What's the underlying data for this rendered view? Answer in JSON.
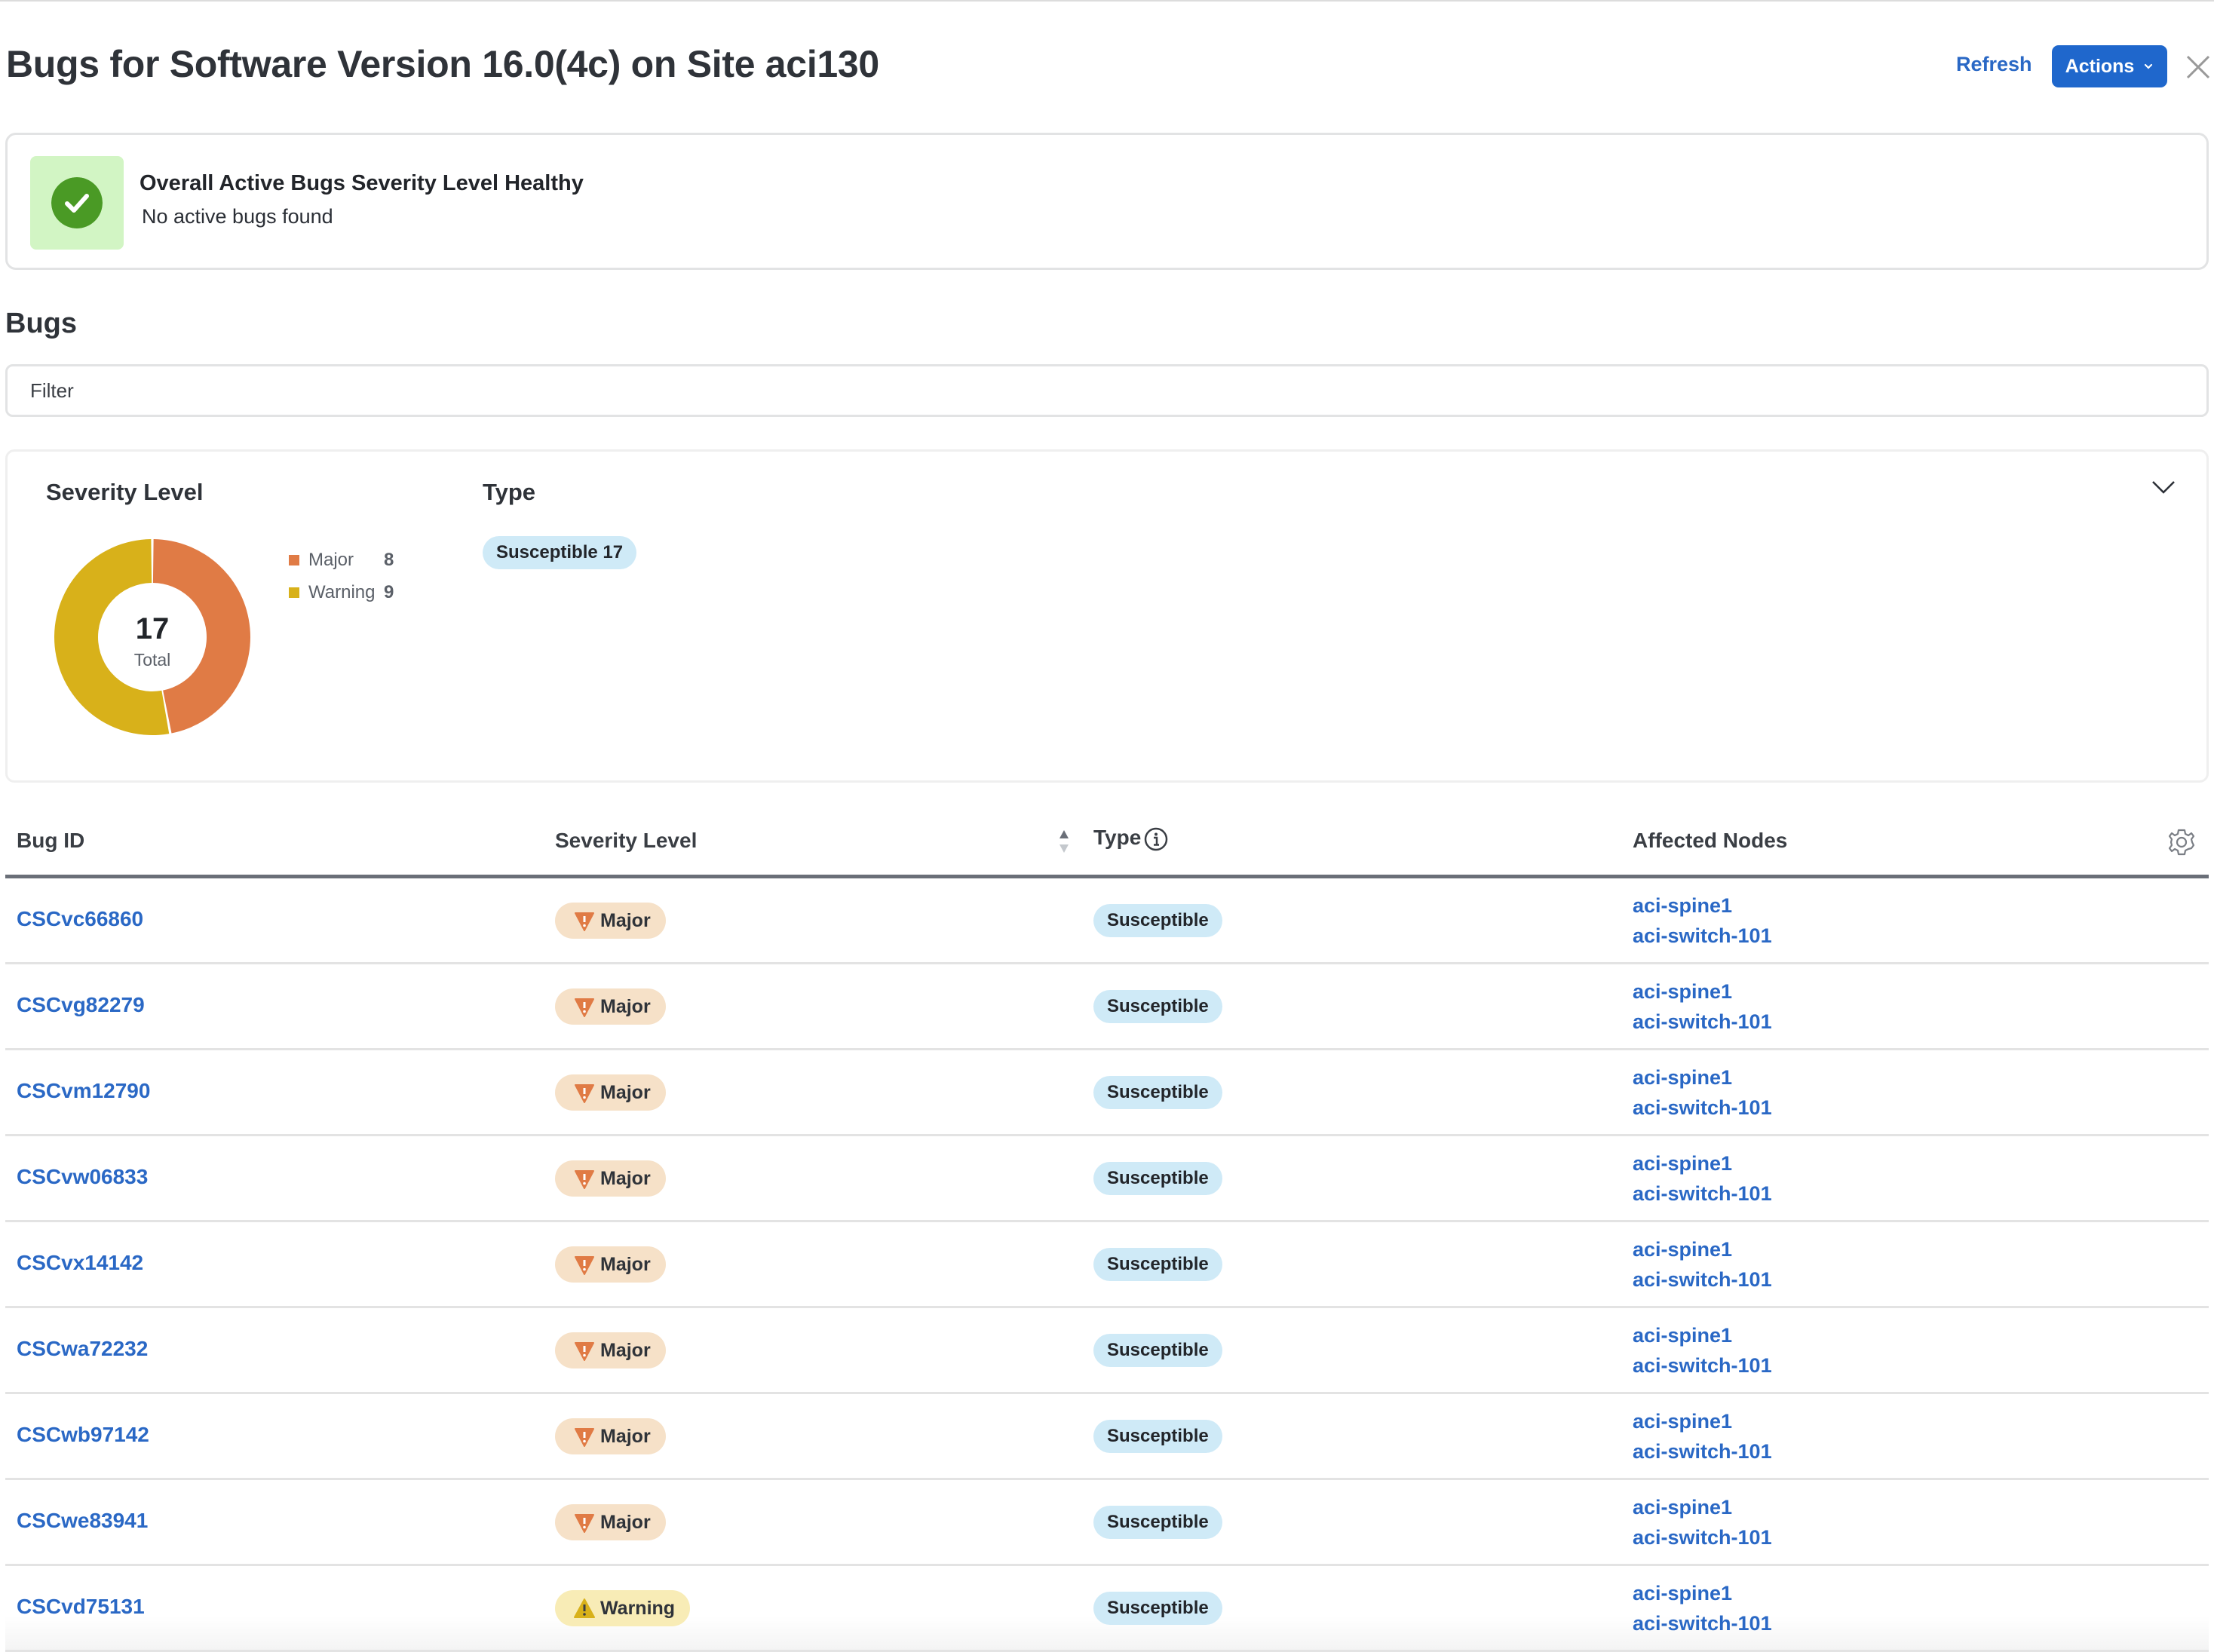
{
  "header": {
    "title": "Bugs for Software Version 16.0(4c) on Site aci130",
    "refresh_label": "Refresh",
    "actions_label": "Actions",
    "close_icon": "close-icon"
  },
  "status": {
    "icon": "check-circle-icon",
    "title": "Overall Active Bugs Severity Level Healthy",
    "subtitle": "No active bugs found",
    "color": "#4a9a25"
  },
  "bugs_section": {
    "heading": "Bugs",
    "filter_placeholder": "Filter"
  },
  "summary": {
    "severity_title": "Severity Level",
    "type_title": "Type",
    "donut_total": "17",
    "donut_total_label": "Total",
    "legend": [
      {
        "label": "Major",
        "value": "8",
        "color": "#e07b45"
      },
      {
        "label": "Warning",
        "value": "9",
        "color": "#d8b11a"
      }
    ],
    "type_chip": "Susceptible 17"
  },
  "chart_data": {
    "type": "pie",
    "title": "Severity Level",
    "categories": [
      "Major",
      "Warning"
    ],
    "values": [
      8,
      9
    ],
    "colors": [
      "#e07b45",
      "#d8b11a"
    ],
    "center_label": "17 Total",
    "legend": "right"
  },
  "table": {
    "columns": {
      "bug_id": "Bug ID",
      "severity": "Severity Level",
      "type": "Type",
      "affected_nodes": "Affected Nodes"
    },
    "rows": [
      {
        "bug_id": "CSCvc66860",
        "severity": "Major",
        "type": "Susceptible",
        "nodes": [
          "aci-spine1",
          "aci-switch-101"
        ]
      },
      {
        "bug_id": "CSCvg82279",
        "severity": "Major",
        "type": "Susceptible",
        "nodes": [
          "aci-spine1",
          "aci-switch-101"
        ]
      },
      {
        "bug_id": "CSCvm12790",
        "severity": "Major",
        "type": "Susceptible",
        "nodes": [
          "aci-spine1",
          "aci-switch-101"
        ]
      },
      {
        "bug_id": "CSCvw06833",
        "severity": "Major",
        "type": "Susceptible",
        "nodes": [
          "aci-spine1",
          "aci-switch-101"
        ]
      },
      {
        "bug_id": "CSCvx14142",
        "severity": "Major",
        "type": "Susceptible",
        "nodes": [
          "aci-spine1",
          "aci-switch-101"
        ]
      },
      {
        "bug_id": "CSCwa72232",
        "severity": "Major",
        "type": "Susceptible",
        "nodes": [
          "aci-spine1",
          "aci-switch-101"
        ]
      },
      {
        "bug_id": "CSCwb97142",
        "severity": "Major",
        "type": "Susceptible",
        "nodes": [
          "aci-spine1",
          "aci-switch-101"
        ]
      },
      {
        "bug_id": "CSCwe83941",
        "severity": "Major",
        "type": "Susceptible",
        "nodes": [
          "aci-spine1",
          "aci-switch-101"
        ]
      },
      {
        "bug_id": "CSCvd75131",
        "severity": "Warning",
        "type": "Susceptible",
        "nodes": [
          "aci-spine1",
          "aci-switch-101"
        ]
      }
    ]
  }
}
